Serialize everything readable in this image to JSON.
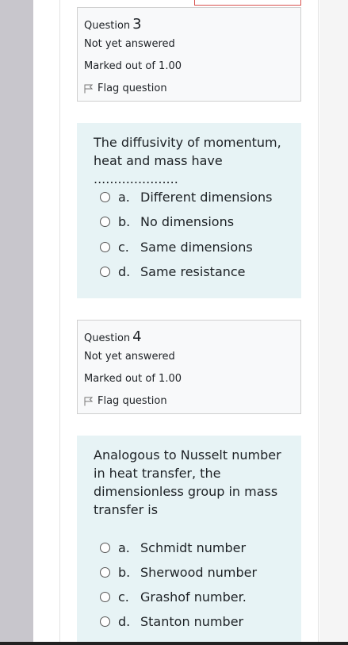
{
  "questions": [
    {
      "label": "Question",
      "number": "3",
      "state": "Not yet answered",
      "grade": "Marked out of 1.00",
      "flag": "Flag question",
      "text_lines": [
        "The diffusivity of momentum,",
        "heat and mass have ....................."
      ],
      "options": [
        {
          "letter": "a.",
          "text": "Different dimensions"
        },
        {
          "letter": "b.",
          "text": "No dimensions"
        },
        {
          "letter": "c.",
          "text": "Same dimensions"
        },
        {
          "letter": "d.",
          "text": "Same resistance"
        }
      ]
    },
    {
      "label": "Question",
      "number": "4",
      "state": "Not yet answered",
      "grade": "Marked out of 1.00",
      "flag": "Flag question",
      "text_lines": [
        "Analogous to Nusselt number",
        "in heat transfer, the",
        "dimensionless group in mass",
        "transfer is"
      ],
      "options": [
        {
          "letter": "a.",
          "text": "Schmidt number"
        },
        {
          "letter": "b.",
          "text": "Sherwood number"
        },
        {
          "letter": "c.",
          "text": "Grashof number."
        },
        {
          "letter": "d.",
          "text": "Stanton number"
        }
      ]
    }
  ],
  "icons": {
    "flag": "flag-icon",
    "radio": "radio-button"
  },
  "colors": {
    "info_bg": "#f8f9fa",
    "content_bg": "#e7f3f5",
    "border": "#cfcfcf",
    "top_accent": "#d9534f"
  }
}
